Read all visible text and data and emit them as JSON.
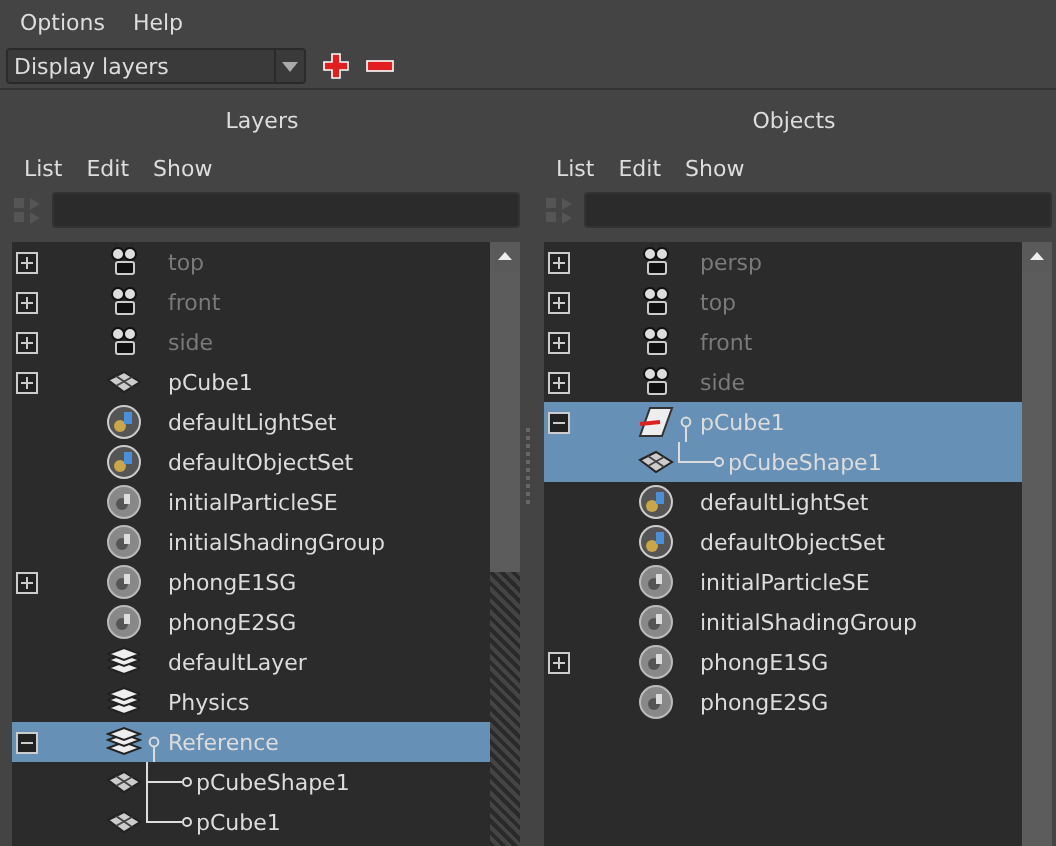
{
  "menu": [
    "Options",
    "Help"
  ],
  "layer_type": {
    "value": "Display layers"
  },
  "panels": [
    {
      "title": "Layers",
      "menu": [
        "List",
        "Edit",
        "Show"
      ],
      "items": [
        {
          "label": "top",
          "kind": "camera",
          "expanded": false,
          "dimmed": true,
          "selected": false
        },
        {
          "label": "front",
          "kind": "camera",
          "expanded": false,
          "dimmed": true,
          "selected": false
        },
        {
          "label": "side",
          "kind": "camera",
          "expanded": false,
          "dimmed": true,
          "selected": false
        },
        {
          "label": "pCube1",
          "kind": "mesh",
          "expanded": false,
          "dimmed": false,
          "selected": false
        },
        {
          "label": "defaultLightSet",
          "kind": "set",
          "dimmed": false,
          "selected": false
        },
        {
          "label": "defaultObjectSet",
          "kind": "set",
          "dimmed": false,
          "selected": false
        },
        {
          "label": "initialParticleSE",
          "kind": "shader",
          "dimmed": false,
          "selected": false
        },
        {
          "label": "initialShadingGroup",
          "kind": "shader",
          "dimmed": false,
          "selected": false
        },
        {
          "label": "phongE1SG",
          "kind": "shader",
          "expanded": false,
          "dimmed": false,
          "selected": false
        },
        {
          "label": "phongE2SG",
          "kind": "shader",
          "dimmed": false,
          "selected": false
        },
        {
          "label": "defaultLayer",
          "kind": "layer",
          "dimmed": false,
          "selected": false
        },
        {
          "label": "Physics",
          "kind": "layer",
          "dimmed": false,
          "selected": false
        },
        {
          "label": "Reference",
          "kind": "layer",
          "expanded": true,
          "dimmed": false,
          "selected": true,
          "children": [
            {
              "label": "pCubeShape1",
              "kind": "mesh",
              "dimmed": false,
              "selected": false
            },
            {
              "label": "pCube1",
              "kind": "mesh",
              "dimmed": false,
              "selected": false
            }
          ]
        }
      ]
    },
    {
      "title": "Objects",
      "menu": [
        "List",
        "Edit",
        "Show"
      ],
      "items": [
        {
          "label": "persp",
          "kind": "camera",
          "expanded": false,
          "dimmed": true,
          "selected": false
        },
        {
          "label": "top",
          "kind": "camera",
          "expanded": false,
          "dimmed": true,
          "selected": false
        },
        {
          "label": "front",
          "kind": "camera",
          "expanded": false,
          "dimmed": true,
          "selected": false
        },
        {
          "label": "side",
          "kind": "camera",
          "expanded": false,
          "dimmed": true,
          "selected": false
        },
        {
          "label": "pCube1",
          "kind": "transform",
          "expanded": true,
          "dimmed": false,
          "selected": true,
          "children": [
            {
              "label": "pCubeShape1",
              "kind": "mesh",
              "dimmed": false,
              "selected": true
            }
          ]
        },
        {
          "label": "defaultLightSet",
          "kind": "set",
          "dimmed": false,
          "selected": false
        },
        {
          "label": "defaultObjectSet",
          "kind": "set",
          "dimmed": false,
          "selected": false
        },
        {
          "label": "initialParticleSE",
          "kind": "shader",
          "dimmed": false,
          "selected": false
        },
        {
          "label": "initialShadingGroup",
          "kind": "shader",
          "dimmed": false,
          "selected": false
        },
        {
          "label": "phongE1SG",
          "kind": "shader",
          "expanded": false,
          "dimmed": false,
          "selected": false
        },
        {
          "label": "phongE2SG",
          "kind": "shader",
          "dimmed": false,
          "selected": false
        }
      ]
    }
  ]
}
